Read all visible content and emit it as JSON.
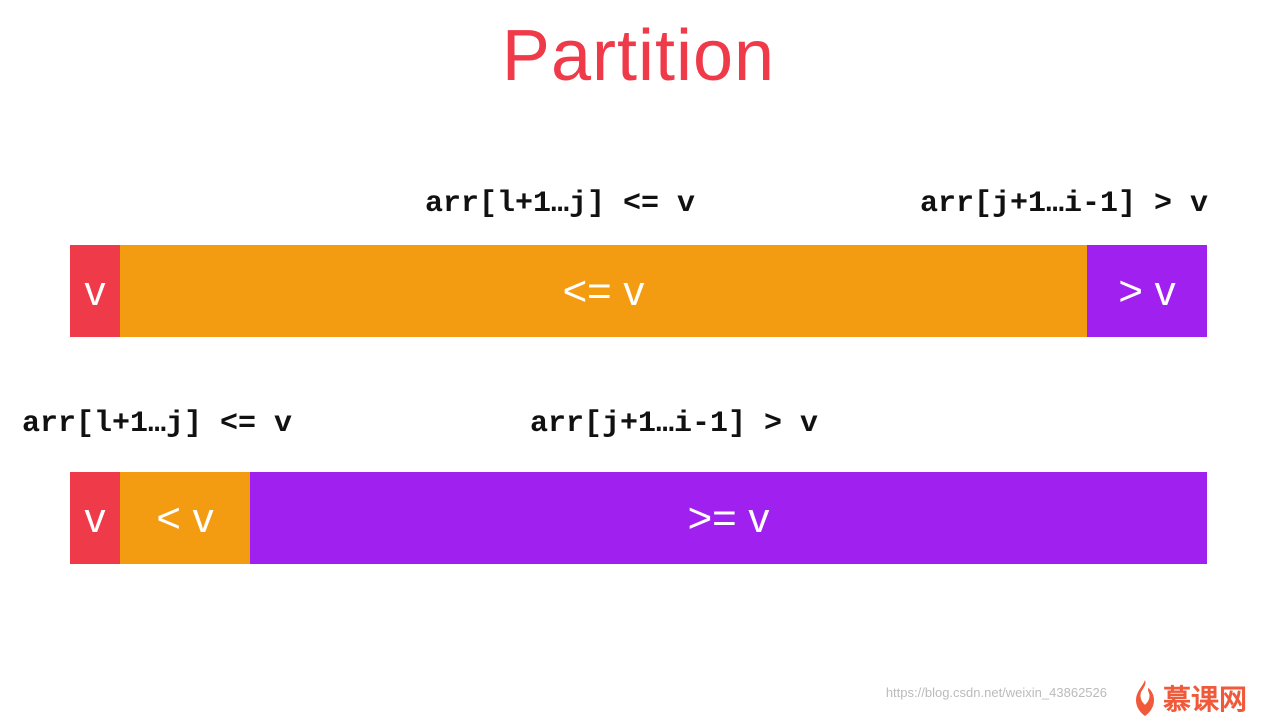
{
  "title": "Partition",
  "colors": {
    "pivot": "#ef3a4a",
    "orange": "#f39c12",
    "purple": "#a020f0",
    "title": "#ef3a4a"
  },
  "row1": {
    "labels": {
      "left": "arr[l+1…j] <= v",
      "right": "arr[j+1…i-1] > v"
    },
    "segments": [
      {
        "text": "v",
        "color": "pivot",
        "flex": "0 0 50px"
      },
      {
        "text": "<= v",
        "color": "orange",
        "flex": "1 1 auto"
      },
      {
        "text": "> v",
        "color": "purple",
        "flex": "0 0 120px"
      }
    ]
  },
  "row2": {
    "labels": {
      "left": "arr[l+1…j] <= v",
      "right": "arr[j+1…i-1] > v"
    },
    "segments": [
      {
        "text": "v",
        "color": "pivot",
        "flex": "0 0 50px"
      },
      {
        "text": "< v",
        "color": "orange",
        "flex": "0 0 130px"
      },
      {
        "text": ">= v",
        "color": "purple",
        "flex": "1 1 auto"
      }
    ]
  },
  "watermark": {
    "url": "https://blog.csdn.net/weixin_43862526",
    "brand": "慕课网"
  }
}
